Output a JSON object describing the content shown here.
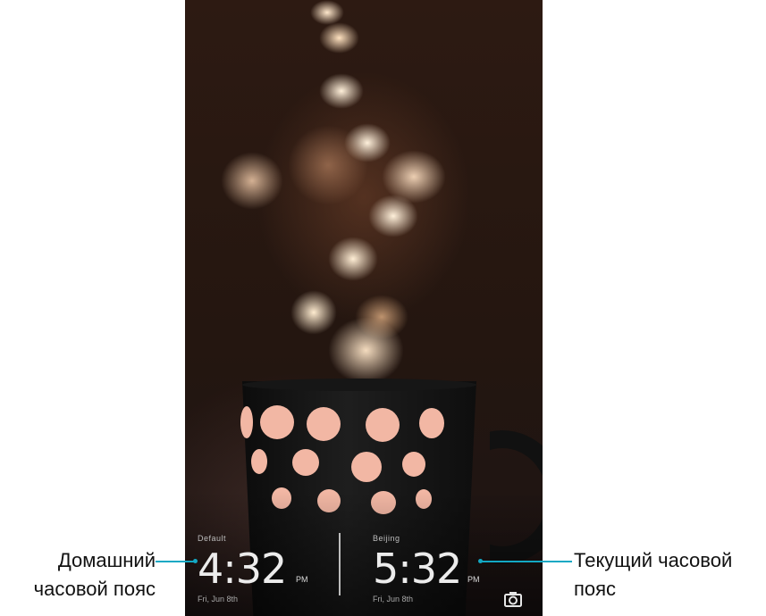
{
  "lockscreen": {
    "home_clock": {
      "city": "Default",
      "time": "4:32",
      "ampm": "PM",
      "date": "Fri, Jun 8th"
    },
    "current_clock": {
      "city": "Beijing",
      "time": "5:32",
      "ampm": "PM",
      "date": "Fri, Jun 8th"
    },
    "camera_icon": "camera-icon"
  },
  "callouts": {
    "home_timezone_line1": "Домашний",
    "home_timezone_line2": "часовой пояс",
    "current_timezone_line1": "Текущий часовой",
    "current_timezone_line2": "пояс"
  },
  "colors": {
    "accent": "#13a8c4",
    "dot": "#f2b7a4"
  }
}
